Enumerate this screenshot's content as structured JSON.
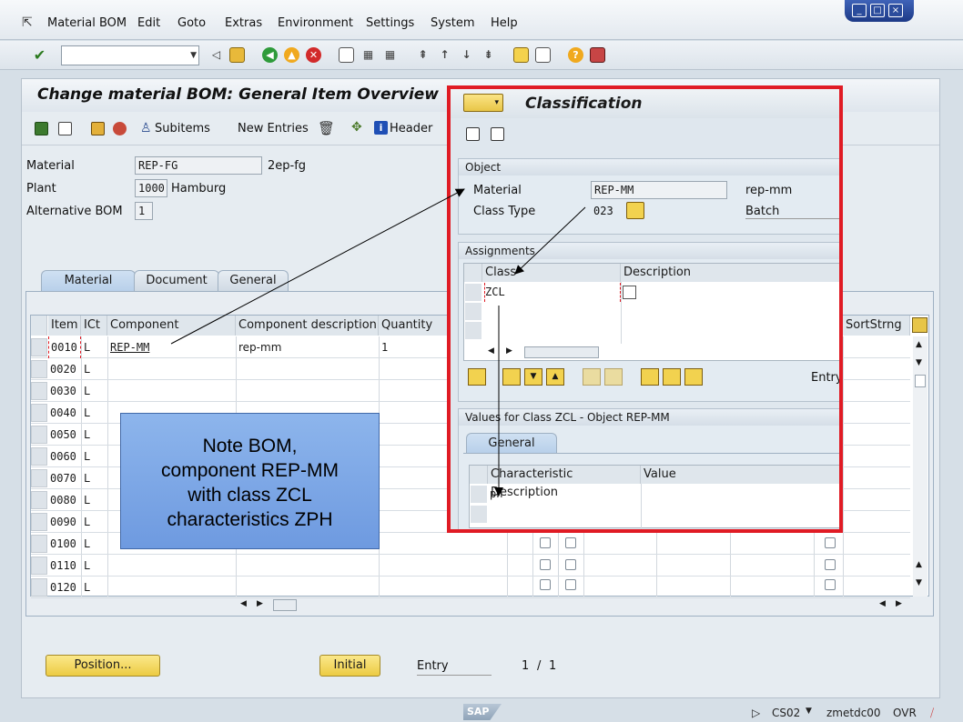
{
  "menu": {
    "items": [
      "Material BOM",
      "Edit",
      "Goto",
      "Extras",
      "Environment",
      "Settings",
      "System",
      "Help"
    ]
  },
  "window": {
    "buttons": [
      "_",
      "□",
      "×"
    ]
  },
  "screen": {
    "title": "Change material BOM: General Item Overview",
    "toolbar": {
      "subitems": "Subitems",
      "new_entries": "New Entries",
      "header": "Header"
    }
  },
  "header_fields": {
    "material_label": "Material",
    "material_value": "REP-FG",
    "material_desc": "2ep-fg",
    "plant_label": "Plant",
    "plant_value": "1000",
    "plant_desc": "Hamburg",
    "altbom_label": "Alternative BOM",
    "altbom_value": "1"
  },
  "tabs": [
    "Material",
    "Document",
    "General"
  ],
  "table": {
    "headers": {
      "item": "Item",
      "ict": "ICt",
      "component": "Component",
      "comp_desc": "Component description",
      "quantity": "Quantity",
      "sortstrng": "SortStrng"
    },
    "rows": [
      {
        "item": "0010",
        "ict": "L",
        "component": "REP-MM",
        "desc": "rep-mm",
        "qty": "1"
      },
      {
        "item": "0020",
        "ict": "L",
        "component": "",
        "desc": "",
        "qty": ""
      },
      {
        "item": "0030",
        "ict": "L",
        "component": "",
        "desc": "",
        "qty": ""
      },
      {
        "item": "0040",
        "ict": "L",
        "component": "",
        "desc": "",
        "qty": ""
      },
      {
        "item": "0050",
        "ict": "L",
        "component": "",
        "desc": "",
        "qty": ""
      },
      {
        "item": "0060",
        "ict": "L",
        "component": "",
        "desc": "",
        "qty": ""
      },
      {
        "item": "0070",
        "ict": "L",
        "component": "",
        "desc": "",
        "qty": ""
      },
      {
        "item": "0080",
        "ict": "L",
        "component": "",
        "desc": "",
        "qty": ""
      },
      {
        "item": "0090",
        "ict": "L",
        "component": "",
        "desc": "",
        "qty": ""
      },
      {
        "item": "0100",
        "ict": "L",
        "component": "",
        "desc": "",
        "qty": ""
      },
      {
        "item": "0110",
        "ict": "L",
        "component": "",
        "desc": "",
        "qty": ""
      },
      {
        "item": "0120",
        "ict": "L",
        "component": "",
        "desc": "",
        "qty": ""
      }
    ]
  },
  "note": {
    "lines": [
      "Note BOM,",
      "component REP-MM",
      "with class ZCL",
      "characteristics ZPH"
    ]
  },
  "bottom": {
    "position_btn": "Position...",
    "initial_btn": "Initial",
    "entry_label": "Entry",
    "entry_current": "1",
    "entry_sep": "/",
    "entry_total": "1"
  },
  "classification": {
    "title": "Classification",
    "object_group": "Object",
    "material_label": "Material",
    "material_value": "REP-MM",
    "material_desc": "rep-mm",
    "classtype_label": "Class Type",
    "classtype_value": "023",
    "classtype_desc": "Batch",
    "assignments_group": "Assignments",
    "col_class": "Class",
    "col_description": "Description",
    "class_value": "ZCL",
    "entry_label": "Entry",
    "values_group": "Values for Class ZCL - Object REP-MM",
    "general_tab": "General",
    "col_char_desc": "Characteristic Description",
    "col_value": "Value",
    "char_value": "ph"
  },
  "status": {
    "sap_logo": "SAP",
    "tcode": "CS02",
    "server": "zmetdc00",
    "mode": "OVR"
  },
  "colors": {
    "highlight_border": "#e01b24",
    "note_fill": "#7ea9e6",
    "button_yellow": "#f4d95e"
  }
}
